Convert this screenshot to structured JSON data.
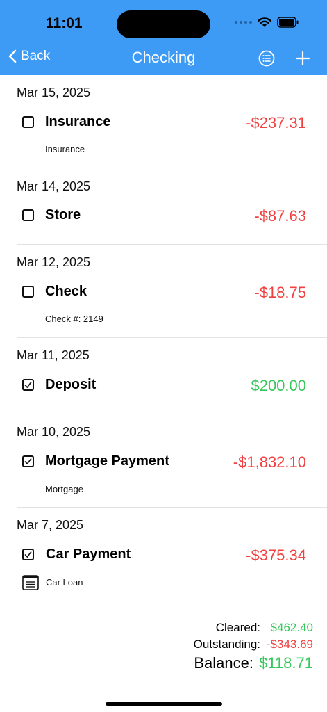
{
  "status_bar": {
    "time": "11:01"
  },
  "nav": {
    "back_label": "Back",
    "title": "Checking"
  },
  "transactions": [
    {
      "date": "Mar 15, 2025",
      "cleared": false,
      "name": "Insurance",
      "amount": "-$237.31",
      "note": "Insurance"
    },
    {
      "date": "Mar 14, 2025",
      "cleared": false,
      "name": "Store",
      "amount": "-$87.63",
      "note": ""
    },
    {
      "date": "Mar 12, 2025",
      "cleared": false,
      "name": "Check",
      "amount": "-$18.75",
      "note": "Check #: 2149"
    },
    {
      "date": "Mar 11, 2025",
      "cleared": true,
      "name": "Deposit",
      "amount": "$200.00",
      "note": ""
    },
    {
      "date": "Mar 10, 2025",
      "cleared": true,
      "name": "Mortgage Payment",
      "amount": "-$1,832.10",
      "note": "Mortgage"
    },
    {
      "date": "Mar 7, 2025",
      "cleared": true,
      "name": "Car Payment",
      "amount": "-$375.34",
      "note": "Car Loan",
      "note_icon": "calendar-icon"
    }
  ],
  "summary": {
    "cleared_label": "Cleared:",
    "cleared_value": "$462.40",
    "outstanding_label": "Outstanding:",
    "outstanding_value": "-$343.69",
    "balance_label": "Balance:",
    "balance_value": "$118.71"
  },
  "colors": {
    "nav_bg": "#3d9bf5",
    "negative": "#f04040",
    "positive": "#34c759"
  }
}
